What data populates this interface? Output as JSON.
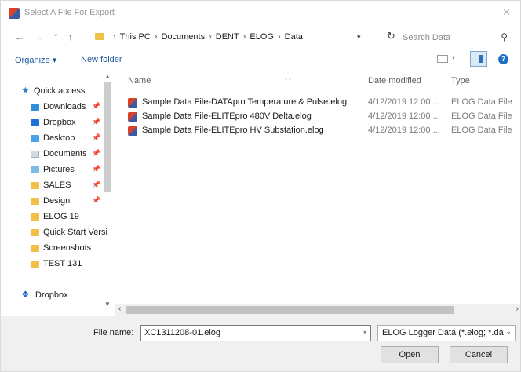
{
  "window": {
    "title": "Select A File For Export",
    "close_glyph": "✕"
  },
  "nav": {
    "back_glyph": "←",
    "forward_glyph": "→",
    "recent_glyph": "⌄",
    "up_glyph": "↑",
    "breadcrumb": [
      "This PC",
      "Documents",
      "DENT",
      "ELOG",
      "Data"
    ],
    "refresh_glyph": "↻",
    "search_placeholder": "Search Data"
  },
  "toolbar": {
    "organize_label": "Organize ▾",
    "new_folder_label": "New folder",
    "help_glyph": "?"
  },
  "sidebar": {
    "items": [
      {
        "label": "Quick access",
        "icon": "star-icon",
        "pinned": false
      },
      {
        "label": "Downloads",
        "icon": "downloads-icon",
        "pinned": true
      },
      {
        "label": "Dropbox",
        "icon": "dropbox-icon",
        "pinned": true
      },
      {
        "label": "Desktop",
        "icon": "desktop-icon",
        "pinned": true
      },
      {
        "label": "Documents",
        "icon": "documents-icon",
        "pinned": true
      },
      {
        "label": "Pictures",
        "icon": "pictures-icon",
        "pinned": true
      },
      {
        "label": "SALES",
        "icon": "folder-icon",
        "pinned": true
      },
      {
        "label": "Design",
        "icon": "folder-icon",
        "pinned": true
      },
      {
        "label": "ELOG 19",
        "icon": "folder-icon",
        "pinned": false
      },
      {
        "label": "Quick Start Versi",
        "icon": "folder-icon",
        "pinned": false
      },
      {
        "label": "Screenshots",
        "icon": "folder-icon",
        "pinned": false
      },
      {
        "label": "TEST 131",
        "icon": "folder-icon",
        "pinned": false
      },
      {
        "label": "Dropbox",
        "icon": "dropbox-icon",
        "pinned": false
      }
    ]
  },
  "files": {
    "columns": {
      "name": "Name",
      "date": "Date modified",
      "type": "Type"
    },
    "rows": [
      {
        "name": "Sample Data File-DATApro Temperature & Pulse.elog",
        "date": "4/12/2019 12:00 ...",
        "type": "ELOG Data File"
      },
      {
        "name": "Sample Data File-ELITEpro 480V Delta.elog",
        "date": "4/12/2019 12:00 ...",
        "type": "ELOG Data File"
      },
      {
        "name": "Sample Data File-ELITEpro HV Substation.elog",
        "date": "4/12/2019 12:00 ...",
        "type": "ELOG Data File"
      }
    ]
  },
  "footer": {
    "file_name_label": "File name:",
    "file_name_value": "XC1311208-01.elog",
    "file_type_value": "ELOG Logger Data (*.elog; *.dat",
    "open_label": "Open",
    "cancel_label": "Cancel"
  },
  "colors": {
    "accent": "#1e5aa0",
    "folder": "#f0c048",
    "footer_bg": "#f0f0f0"
  }
}
